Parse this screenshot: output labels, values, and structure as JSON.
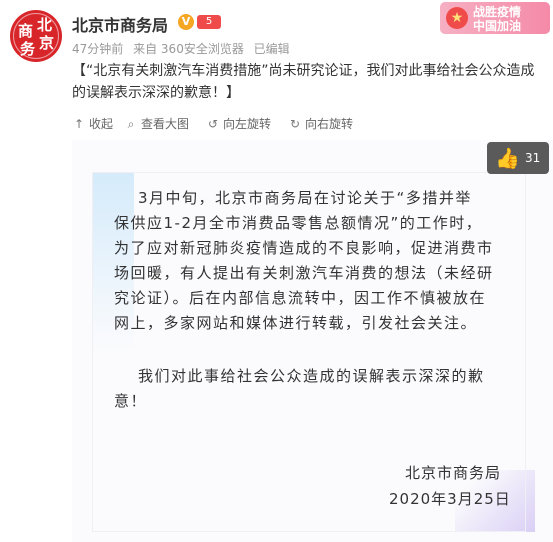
{
  "avatar": {
    "glyphs": [
      "北",
      "京",
      "商",
      "务"
    ]
  },
  "author": {
    "name": "北京市商务局",
    "verified": "V",
    "level": "5"
  },
  "meta": {
    "time": "47分钟前",
    "source": "来自 360安全浏览器",
    "edited": "已编辑"
  },
  "promo": {
    "line1": "战胜疫情",
    "line2": "中国加油",
    "icon": "★"
  },
  "post": {
    "text": "【“北京有关刺激汽车消费措施”尚未研究论证，我们对此事给社会公众造成的误解表示深深的歉意！】"
  },
  "toolbar": {
    "collapse": "收起",
    "view_large": "查看大图",
    "rotate_left": "向左旋转",
    "rotate_right": "向右旋转"
  },
  "like": {
    "count": "31"
  },
  "letter": {
    "lines": [
      "3月中旬，北京市商务局在讨论关于“多措并举",
      "保供应1-2月全市消费品零售总额情况”的工作时，",
      "为了应对新冠肺炎疫情造成的不良影响，促进消费市",
      "场回暖，有人提出有关刺激汽车消费的想法（未经研",
      "究论证）。后在内部信息流转中，因工作不慎被放在",
      "网上，多家网站和媒体进行转载，引发社会关注。"
    ],
    "apology": [
      "我们对此事给社会公众造成的误解表示深深的歉",
      "意！"
    ],
    "signature": "北京市商务局",
    "date": "2020年3月25日"
  }
}
